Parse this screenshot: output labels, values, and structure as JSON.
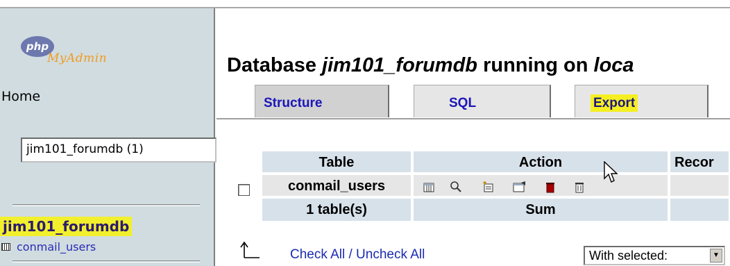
{
  "app": {
    "logo_php": "php",
    "logo_myadmin": "MyAdmin"
  },
  "sidebar": {
    "home_label": "Home",
    "db_select_value": "jim101_forumdb (1)",
    "current_db": "jim101_forumdb",
    "tables": [
      {
        "name": "conmail_users",
        "icon": "table-icon"
      }
    ]
  },
  "main": {
    "title_prefix": "Database ",
    "title_db": "jim101_forumdb",
    "title_mid": " running on ",
    "title_host": "loca",
    "tabs": [
      {
        "label": "Structure",
        "active": true
      },
      {
        "label": "SQL",
        "active": false
      },
      {
        "label": "Export",
        "highlighted": true
      }
    ],
    "table": {
      "headers": [
        "Table",
        "Action",
        "Recor"
      ],
      "rows": [
        {
          "name": "conmail_users",
          "actions": [
            "browse-icon",
            "search-icon",
            "insert-icon",
            "properties-icon",
            "empty-icon",
            "drop-icon"
          ]
        }
      ],
      "footer": {
        "count": "1 table(s)",
        "sum": "Sum"
      }
    },
    "check_all_label": "Check All",
    "check_sep": " / ",
    "uncheck_all_label": "Uncheck All",
    "with_selected_label": "With selected:"
  },
  "colors": {
    "sidebar_bg": "#d0dce0",
    "highlight": "#f2f02c",
    "link": "#1c16b8"
  }
}
